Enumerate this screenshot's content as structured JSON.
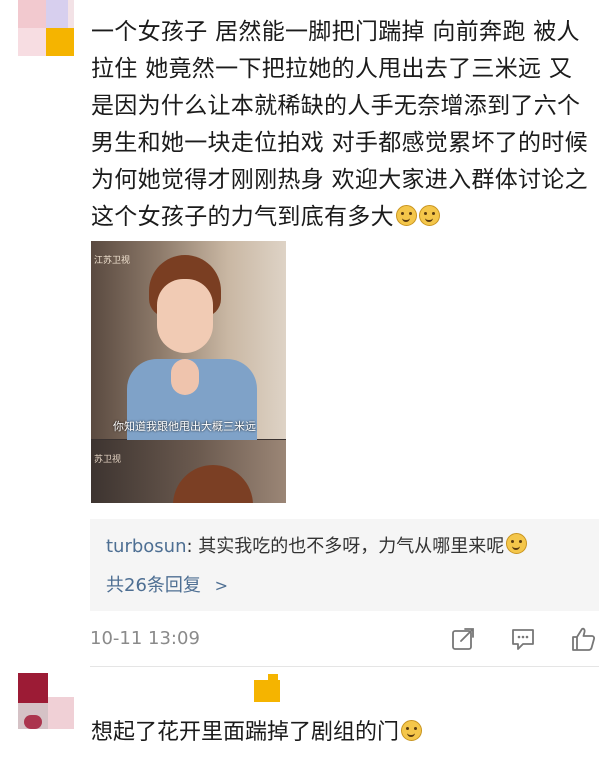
{
  "post": {
    "text": "一个女孩子 居然能一脚把门踹掉 向前奔跑 被人拉住 她竟然一下把拉她的人甩出去了三米远 又是因为什么让本就稀缺的人手无奈增添到了六个男生和她一块走位拍戏 对手都感觉累坏了的时候为何她觉得才刚刚热身 欢迎大家进入群体讨论之这个女孩子的力气到底有多大",
    "emoji_icons": [
      "smile-emoji-icon",
      "smile-emoji-icon"
    ],
    "image": {
      "channel_label": "江苏卫视",
      "caption": "你知道我跟他甩出大概三米远",
      "channel_label_bottom": "苏卫视"
    }
  },
  "reply": {
    "user": "turbosun",
    "text": ": 其实我吃的也不多呀，力气从哪里来呢",
    "emoji_icon": "smile-emoji-icon",
    "more_label": "共26条回复",
    "more_chevron": ">"
  },
  "meta": {
    "timestamp": "10-11 13:09",
    "actions": [
      "share-icon",
      "comment-icon",
      "like-icon"
    ]
  },
  "comment2": {
    "text": "想起了花开里面踹掉了剧组的门",
    "emoji_icon": "laugh-cry-emoji-icon"
  },
  "colors": {
    "link": "#4e6f93",
    "reply_bg": "#f5f5f5",
    "meta_gray": "#8a8a8a",
    "accent_yellow": "#f5b400"
  }
}
